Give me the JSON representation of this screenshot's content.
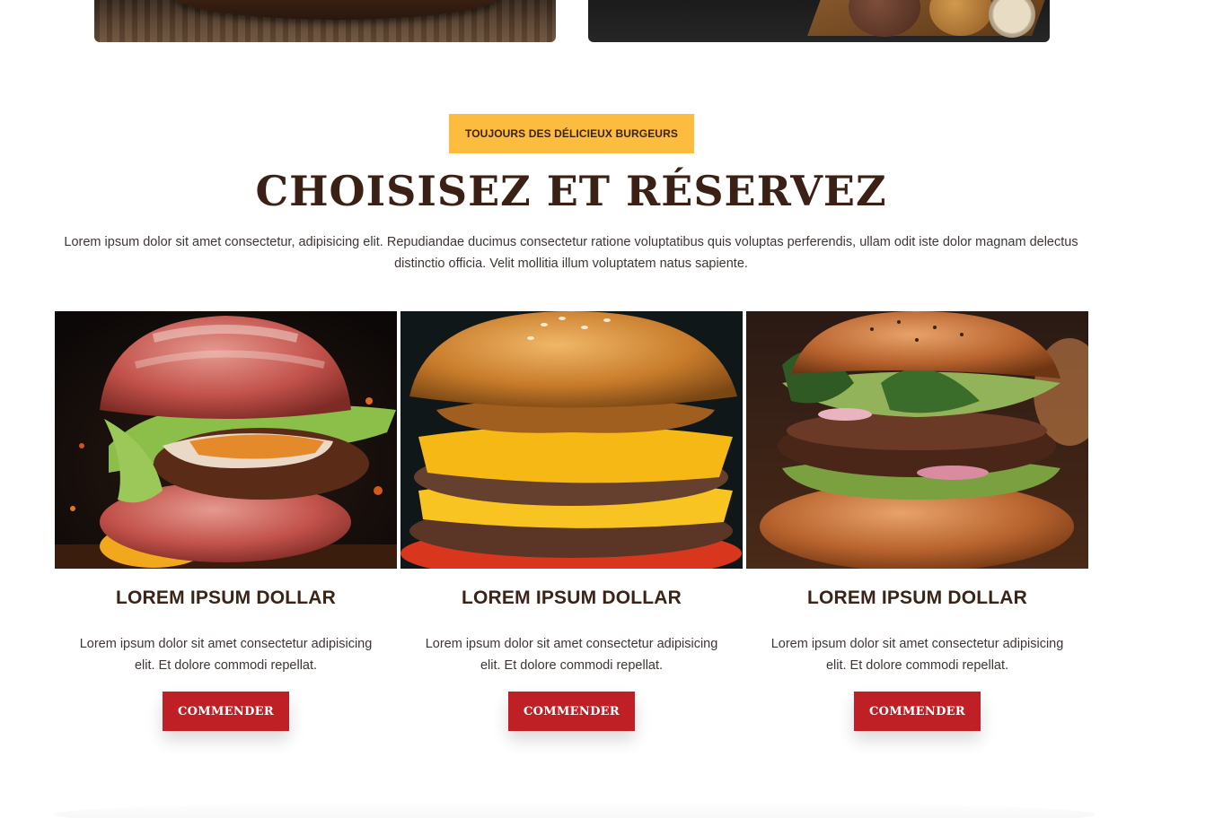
{
  "section": {
    "badge": "TOUJOURS DES DÉLICIEUX BURGEURS",
    "title": "CHOISISEZ ET RÉSERVEZ",
    "intro": "Lorem ipsum dolor sit amet consectetur, adipisicing elit. Repudiandae ducimus consectetur ratione voluptatibus quis voluptas perferendis, ullam odit iste dolor magnam delectus distinctio officia. Velit mollitia illum voluptatem natus sapiente."
  },
  "products": [
    {
      "name": "LOREM IPSUM DOLLAR",
      "description": "Lorem ipsum dolor sit amet consectetur adipisicing elit. Et dolore commodi repellat.",
      "button_label": "COMMENDER"
    },
    {
      "name": "LOREM IPSUM DOLLAR",
      "description": "Lorem ipsum dolor sit amet consectetur adipisicing elit. Et dolore commodi repellat.",
      "button_label": "COMMENDER"
    },
    {
      "name": "LOREM IPSUM DOLLAR",
      "description": "Lorem ipsum dolor sit amet consectetur adipisicing elit. Et dolore commodi repellat.",
      "button_label": "COMMENDER"
    }
  ],
  "colors": {
    "badge_bg": "#fbbc3f",
    "title": "#3b2016",
    "button_bg": "#bf2026",
    "text": "#3f3532"
  }
}
